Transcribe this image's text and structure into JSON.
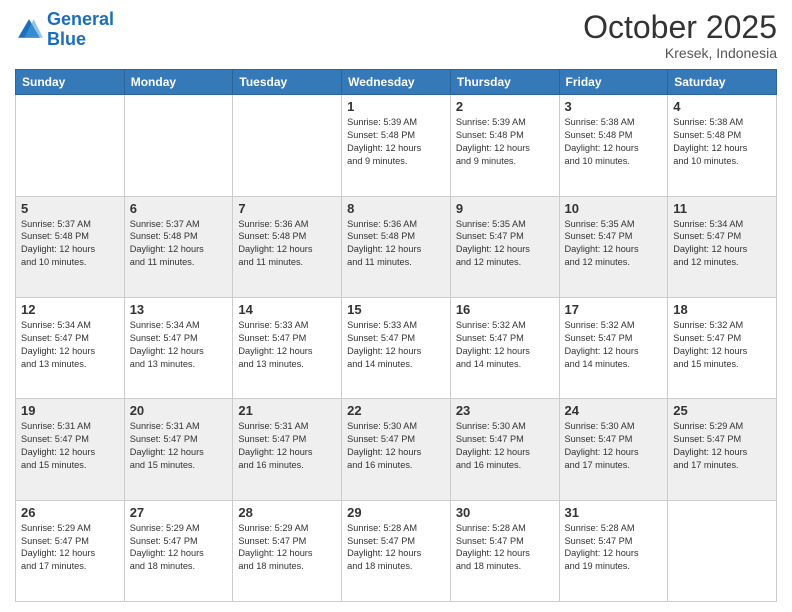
{
  "header": {
    "logo_line1": "General",
    "logo_line2": "Blue",
    "month": "October 2025",
    "location": "Kresek, Indonesia"
  },
  "days_of_week": [
    "Sunday",
    "Monday",
    "Tuesday",
    "Wednesday",
    "Thursday",
    "Friday",
    "Saturday"
  ],
  "weeks": [
    [
      {
        "day": "",
        "info": ""
      },
      {
        "day": "",
        "info": ""
      },
      {
        "day": "",
        "info": ""
      },
      {
        "day": "1",
        "info": "Sunrise: 5:39 AM\nSunset: 5:48 PM\nDaylight: 12 hours\nand 9 minutes."
      },
      {
        "day": "2",
        "info": "Sunrise: 5:39 AM\nSunset: 5:48 PM\nDaylight: 12 hours\nand 9 minutes."
      },
      {
        "day": "3",
        "info": "Sunrise: 5:38 AM\nSunset: 5:48 PM\nDaylight: 12 hours\nand 10 minutes."
      },
      {
        "day": "4",
        "info": "Sunrise: 5:38 AM\nSunset: 5:48 PM\nDaylight: 12 hours\nand 10 minutes."
      }
    ],
    [
      {
        "day": "5",
        "info": "Sunrise: 5:37 AM\nSunset: 5:48 PM\nDaylight: 12 hours\nand 10 minutes."
      },
      {
        "day": "6",
        "info": "Sunrise: 5:37 AM\nSunset: 5:48 PM\nDaylight: 12 hours\nand 11 minutes."
      },
      {
        "day": "7",
        "info": "Sunrise: 5:36 AM\nSunset: 5:48 PM\nDaylight: 12 hours\nand 11 minutes."
      },
      {
        "day": "8",
        "info": "Sunrise: 5:36 AM\nSunset: 5:48 PM\nDaylight: 12 hours\nand 11 minutes."
      },
      {
        "day": "9",
        "info": "Sunrise: 5:35 AM\nSunset: 5:47 PM\nDaylight: 12 hours\nand 12 minutes."
      },
      {
        "day": "10",
        "info": "Sunrise: 5:35 AM\nSunset: 5:47 PM\nDaylight: 12 hours\nand 12 minutes."
      },
      {
        "day": "11",
        "info": "Sunrise: 5:34 AM\nSunset: 5:47 PM\nDaylight: 12 hours\nand 12 minutes."
      }
    ],
    [
      {
        "day": "12",
        "info": "Sunrise: 5:34 AM\nSunset: 5:47 PM\nDaylight: 12 hours\nand 13 minutes."
      },
      {
        "day": "13",
        "info": "Sunrise: 5:34 AM\nSunset: 5:47 PM\nDaylight: 12 hours\nand 13 minutes."
      },
      {
        "day": "14",
        "info": "Sunrise: 5:33 AM\nSunset: 5:47 PM\nDaylight: 12 hours\nand 13 minutes."
      },
      {
        "day": "15",
        "info": "Sunrise: 5:33 AM\nSunset: 5:47 PM\nDaylight: 12 hours\nand 14 minutes."
      },
      {
        "day": "16",
        "info": "Sunrise: 5:32 AM\nSunset: 5:47 PM\nDaylight: 12 hours\nand 14 minutes."
      },
      {
        "day": "17",
        "info": "Sunrise: 5:32 AM\nSunset: 5:47 PM\nDaylight: 12 hours\nand 14 minutes."
      },
      {
        "day": "18",
        "info": "Sunrise: 5:32 AM\nSunset: 5:47 PM\nDaylight: 12 hours\nand 15 minutes."
      }
    ],
    [
      {
        "day": "19",
        "info": "Sunrise: 5:31 AM\nSunset: 5:47 PM\nDaylight: 12 hours\nand 15 minutes."
      },
      {
        "day": "20",
        "info": "Sunrise: 5:31 AM\nSunset: 5:47 PM\nDaylight: 12 hours\nand 15 minutes."
      },
      {
        "day": "21",
        "info": "Sunrise: 5:31 AM\nSunset: 5:47 PM\nDaylight: 12 hours\nand 16 minutes."
      },
      {
        "day": "22",
        "info": "Sunrise: 5:30 AM\nSunset: 5:47 PM\nDaylight: 12 hours\nand 16 minutes."
      },
      {
        "day": "23",
        "info": "Sunrise: 5:30 AM\nSunset: 5:47 PM\nDaylight: 12 hours\nand 16 minutes."
      },
      {
        "day": "24",
        "info": "Sunrise: 5:30 AM\nSunset: 5:47 PM\nDaylight: 12 hours\nand 17 minutes."
      },
      {
        "day": "25",
        "info": "Sunrise: 5:29 AM\nSunset: 5:47 PM\nDaylight: 12 hours\nand 17 minutes."
      }
    ],
    [
      {
        "day": "26",
        "info": "Sunrise: 5:29 AM\nSunset: 5:47 PM\nDaylight: 12 hours\nand 17 minutes."
      },
      {
        "day": "27",
        "info": "Sunrise: 5:29 AM\nSunset: 5:47 PM\nDaylight: 12 hours\nand 18 minutes."
      },
      {
        "day": "28",
        "info": "Sunrise: 5:29 AM\nSunset: 5:47 PM\nDaylight: 12 hours\nand 18 minutes."
      },
      {
        "day": "29",
        "info": "Sunrise: 5:28 AM\nSunset: 5:47 PM\nDaylight: 12 hours\nand 18 minutes."
      },
      {
        "day": "30",
        "info": "Sunrise: 5:28 AM\nSunset: 5:47 PM\nDaylight: 12 hours\nand 18 minutes."
      },
      {
        "day": "31",
        "info": "Sunrise: 5:28 AM\nSunset: 5:47 PM\nDaylight: 12 hours\nand 19 minutes."
      },
      {
        "day": "",
        "info": ""
      }
    ]
  ]
}
